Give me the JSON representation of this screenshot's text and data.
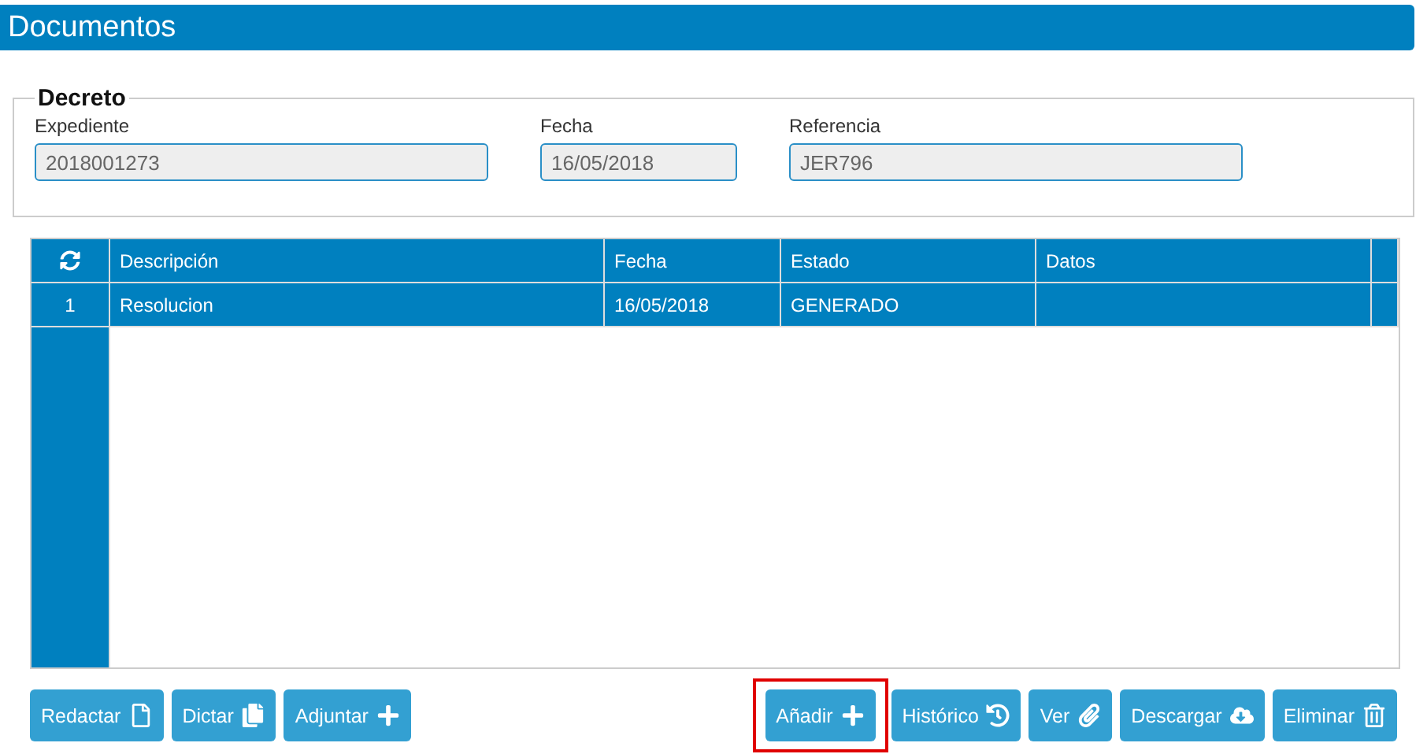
{
  "window": {
    "title": "Documentos"
  },
  "decreto": {
    "legend": "Decreto",
    "fields": [
      {
        "label": "Expediente",
        "value": "2018001273"
      },
      {
        "label": "Fecha",
        "value": "16/05/2018"
      },
      {
        "label": "Referencia",
        "value": "JER796"
      }
    ]
  },
  "table": {
    "columns": [
      "Descripción",
      "Fecha",
      "Estado",
      "Datos"
    ],
    "rows": [
      {
        "number": "1",
        "cells": [
          "Resolucion",
          "16/05/2018",
          "GENERADO",
          ""
        ],
        "selected": true
      }
    ]
  },
  "buttons_left": [
    {
      "label": "Redactar"
    },
    {
      "label": "Dictar"
    },
    {
      "label": "Adjuntar"
    }
  ],
  "buttons_right": [
    {
      "label": "Añadir",
      "highlighted": true
    },
    {
      "label": "Histórico"
    },
    {
      "label": "Ver"
    },
    {
      "label": "Descargar"
    },
    {
      "label": "Eliminar"
    }
  ]
}
